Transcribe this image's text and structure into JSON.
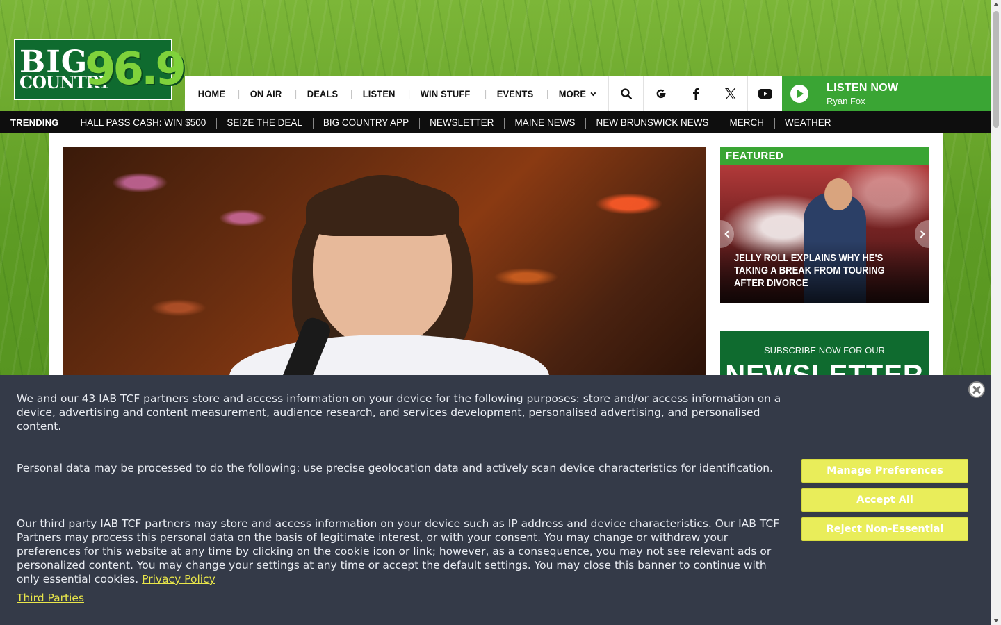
{
  "logo": {
    "line1": "BIG",
    "line2": "COUNTRY",
    "frequency": "96.9"
  },
  "nav": {
    "items": [
      "HOME",
      "ON AIR",
      "DEALS",
      "LISTEN",
      "WIN STUFF",
      "EVENTS",
      "MORE"
    ],
    "icons": [
      "search-icon",
      "google-icon",
      "facebook-icon",
      "x-icon",
      "youtube-icon"
    ],
    "listen_now": "LISTEN NOW",
    "host": "Ryan Fox"
  },
  "trending": {
    "label": "TRENDING",
    "items": [
      "HALL PASS CASH: WIN $500",
      "SEIZE THE DEAL",
      "BIG COUNTRY APP",
      "NEWSLETTER",
      "MAINE NEWS",
      "NEW BRUNSWICK NEWS",
      "MERCH",
      "WEATHER"
    ]
  },
  "featured": {
    "heading": "FEATURED",
    "caption": "Jelly Roll Explains Why He's Taking a Break From Touring After Divorce"
  },
  "newsletter": {
    "subtitle": "SUBSCRIBE NOW FOR OUR",
    "title": "NEWSLETTER"
  },
  "cookie": {
    "p1": "We and our 43 IAB TCF partners store and access information on your device for the following purposes: store and/or access information on a device, advertising and content measurement, audience research, and services development, personalised advertising, and personalised content.",
    "p2": "Personal data may be processed to do the following: use precise geolocation data and actively scan device characteristics for identification.",
    "p3": "Our third party IAB TCF partners may store and access information on your device such as IP address and device characteristics. Our IAB TCF Partners may process this personal data on the basis of legitimate interest, or with your consent. You may change or withdraw your preferences for this website at any time by clicking on the cookie icon or link; however, as a consequence, you may not see relevant ads or personalized content. You may change your settings at any time or accept the default settings. You may close this banner to continue with only essential cookies.",
    "privacy_link": "Privacy Policy",
    "third_parties": "Third Parties",
    "buttons": {
      "manage": "Manage Preferences",
      "accept": "Accept All",
      "reject": "Reject Non-Essential"
    }
  },
  "colors": {
    "brand_green": "#3aa534",
    "dark_green": "#0f6b2f",
    "cookie_bg": "#343a48",
    "cookie_accent": "#e9ed5a"
  }
}
